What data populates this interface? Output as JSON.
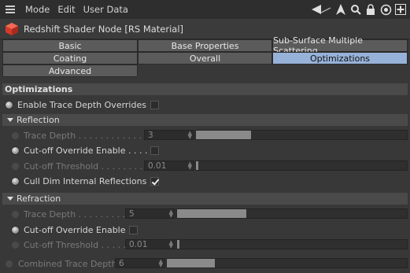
{
  "menubar": {
    "items": [
      "Mode",
      "Edit",
      "User Data"
    ],
    "icons": [
      "list-menu-icon",
      "arrow-back-icon",
      "arrow-up-icon",
      "search-icon",
      "lock-icon",
      "target-icon",
      "add-icon"
    ]
  },
  "header": {
    "title": "Redshift Shader Node [RS Material]"
  },
  "tabs": {
    "basic": "Basic",
    "base_properties": "Base Properties",
    "sss": "Sub-Surface Multiple Scattering",
    "coating": "Coating",
    "overall": "Overall",
    "optimizations": "Optimizations",
    "advanced": "Advanced",
    "active": "Optimizations"
  },
  "optimizations": {
    "section_title": "Optimizations",
    "enable_trace_depth_overrides": {
      "label": "Enable Trace Depth Overrides",
      "checked": false
    },
    "reflection": {
      "title": "Reflection",
      "trace_depth": {
        "label": "Trace Depth . . . . . . . . . . . . .",
        "value": "3",
        "fraction": 0.26
      },
      "cutoff_override_enable": {
        "label": "Cut-off Override Enable . . . .",
        "checked": false
      },
      "cutoff_threshold": {
        "label": "Cut-off Threshold . . . . . . . . .",
        "value": "0.01",
        "fraction": 0.01
      },
      "cull_dim_internal": {
        "label": "Cull Dim Internal Reflections",
        "checked": true
      }
    },
    "refraction": {
      "title": "Refraction",
      "trace_depth": {
        "label": "Trace Depth . . . . . . . . . . .",
        "value": "5",
        "fraction": 0.3
      },
      "cutoff_override_enable": {
        "label": "Cut-off Override Enable",
        "checked": false
      },
      "cutoff_threshold": {
        "label": "Cut-off Threshold . . . . . . .",
        "value": "0.01",
        "fraction": 0.01
      }
    },
    "combined_trace_depth": {
      "label": "Combined Trace Depth",
      "value": "6",
      "fraction": 0.2
    }
  },
  "colors": {
    "background": "#383838",
    "menubar": "#2e2e2e",
    "tab": "#5b5b5b",
    "tab_active": "#97b2d8",
    "redshift_icon": "#d43a2a"
  }
}
